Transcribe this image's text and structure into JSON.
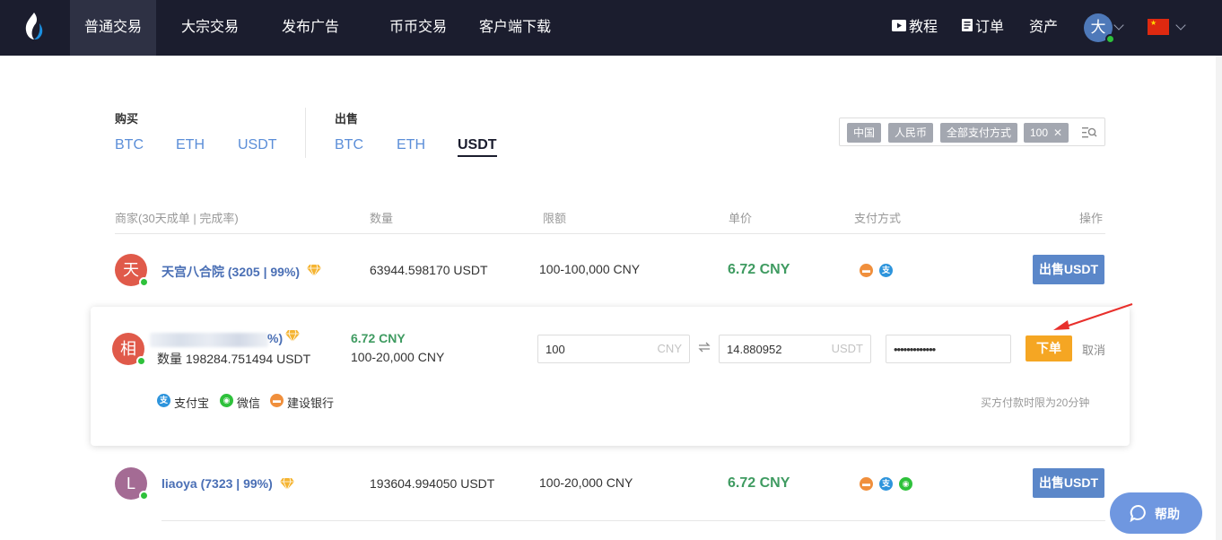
{
  "nav": {
    "items": [
      "普通交易",
      "大宗交易",
      "发布广告",
      "币币交易",
      "客户端下载"
    ],
    "tutorial": "教程",
    "orders": "订单",
    "assets": "资产",
    "avatar_char": "大"
  },
  "buy": {
    "title": "购买",
    "coins": [
      "BTC",
      "ETH",
      "USDT"
    ]
  },
  "sell": {
    "title": "出售",
    "coins": [
      "BTC",
      "ETH",
      "USDT"
    ],
    "active": "USDT"
  },
  "filters": {
    "country": "中国",
    "currency": "人民币",
    "payment": "全部支付方式",
    "amount": "100"
  },
  "table": {
    "headers": {
      "merchant": "商家(30天成单 | 完成率)",
      "quantity": "数量",
      "limit": "限额",
      "price": "单价",
      "payment": "支付方式",
      "action": "操作"
    },
    "rows": [
      {
        "avatar": "天",
        "avatar_color": "#e05a4a",
        "name": "天宫八合院 (3205 | 99%)",
        "quantity": "63944.598170 USDT",
        "limit": "100-100,000 CNY",
        "price": "6.72 CNY",
        "payments": [
          "bank",
          "alipay"
        ],
        "action": "出售USDT"
      },
      {
        "avatar": "L",
        "avatar_color": "#a46b94",
        "name": "liaoya (7323 | 99%)",
        "quantity": "193604.994050 USDT",
        "limit": "100-20,000 CNY",
        "price": "6.72 CNY",
        "payments": [
          "bank",
          "alipay",
          "wechat"
        ],
        "action": "出售USDT"
      }
    ]
  },
  "expanded": {
    "avatar": "相",
    "avatar_color": "#e05a4a",
    "name_suffix": "%)",
    "quantity": "数量 198284.751494 USDT",
    "price": "6.72 CNY",
    "limit": "100-20,000 CNY",
    "cny_value": "100",
    "cny_unit": "CNY",
    "usdt_value": "14.880952",
    "usdt_unit": "USDT",
    "password": "•••••••••••••",
    "order_button": "下单",
    "cancel": "取消",
    "payments": [
      "支付宝",
      "微信",
      "建设银行"
    ],
    "note": "买方付款时限为20分钟"
  },
  "help": "帮助",
  "colors": {
    "nav_bg": "#1b1d2e",
    "link_blue": "#5b8ed8",
    "price_green": "#3f9b61",
    "order_orange": "#f5a623",
    "sell_blue": "#5b87c9",
    "arrow_red": "#e8302c"
  }
}
